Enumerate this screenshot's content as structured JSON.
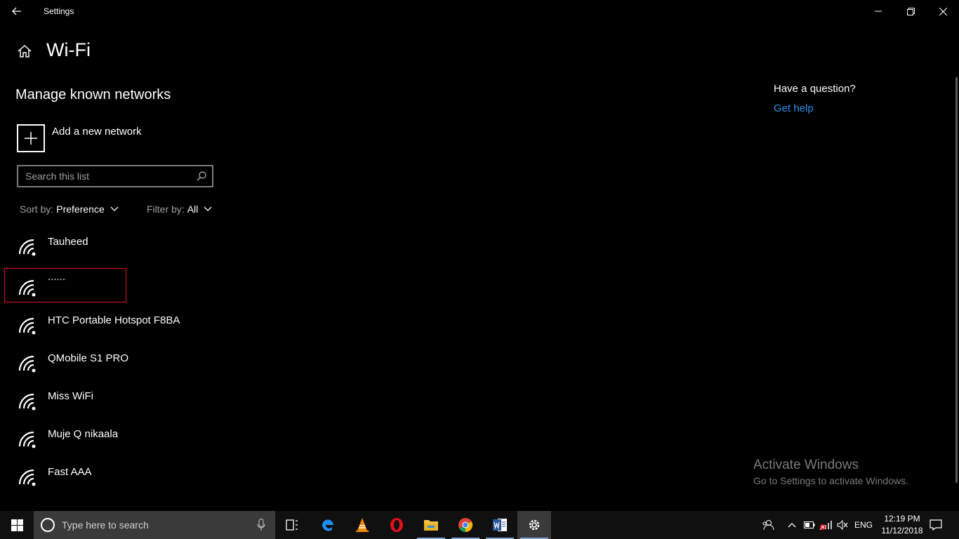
{
  "window": {
    "title": "Settings"
  },
  "page": {
    "title": "Wi-Fi",
    "section_title": "Manage known networks",
    "add_network_label": "Add a new network",
    "search": {
      "placeholder": "Search this list",
      "value": ""
    },
    "sort": {
      "label": "Sort by:",
      "value": "Preference"
    },
    "filter": {
      "label": "Filter by:",
      "value": "All"
    },
    "networks": [
      {
        "name": "Tauheed"
      },
      {
        "name": "......"
      },
      {
        "name": "HTC Portable Hotspot F8BA"
      },
      {
        "name": "QMobile S1 PRO"
      },
      {
        "name": "Miss WiFi"
      },
      {
        "name": "Muje Q nikaala"
      },
      {
        "name": "Fast AAA"
      }
    ]
  },
  "help": {
    "question": "Have a question?",
    "link": "Get help"
  },
  "watermark": {
    "line1": "Activate Windows",
    "line2": "Go to Settings to activate Windows."
  },
  "taskbar": {
    "search_placeholder": "Type here to search",
    "apps": [
      "task-view",
      "edge",
      "vlc",
      "opera",
      "file-explorer",
      "chrome",
      "word",
      "settings"
    ],
    "tray": {
      "language": "ENG"
    },
    "clock": {
      "time": "12:19 PM",
      "date": "11/12/2018"
    }
  },
  "colors": {
    "accent_link": "#2b8fe8",
    "highlight_border": "#e81123",
    "background": "#000000"
  }
}
